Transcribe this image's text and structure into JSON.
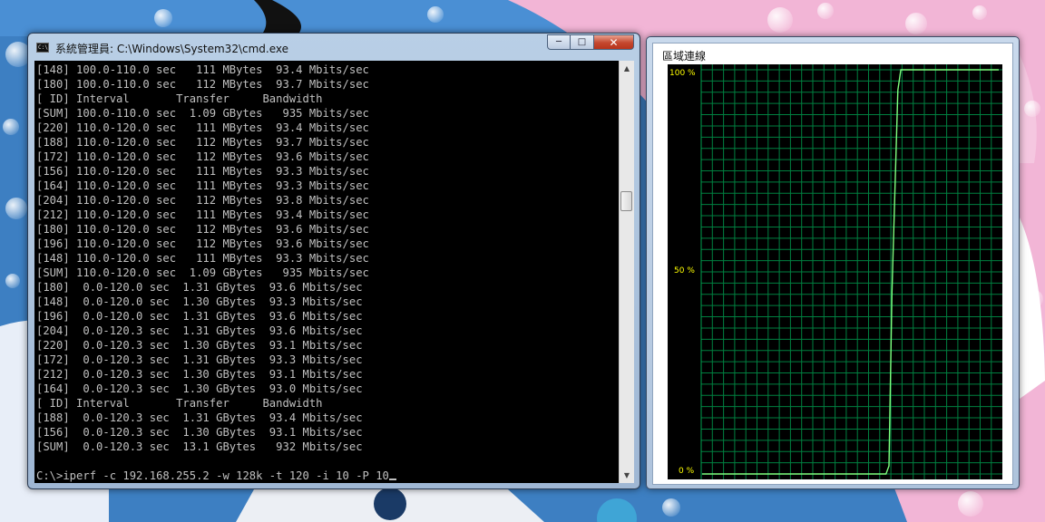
{
  "cmd": {
    "title": "系統管理員: C:\\Windows\\System32\\cmd.exe",
    "app_icon_text": "C:\\",
    "lines": [
      "[148] 100.0-110.0 sec   111 MBytes  93.4 Mbits/sec",
      "[180] 100.0-110.0 sec   112 MBytes  93.7 Mbits/sec",
      "[ ID] Interval       Transfer     Bandwidth",
      "[SUM] 100.0-110.0 sec  1.09 GBytes   935 Mbits/sec",
      "[220] 110.0-120.0 sec   111 MBytes  93.4 Mbits/sec",
      "[188] 110.0-120.0 sec   112 MBytes  93.7 Mbits/sec",
      "[172] 110.0-120.0 sec   112 MBytes  93.6 Mbits/sec",
      "[156] 110.0-120.0 sec   111 MBytes  93.3 Mbits/sec",
      "[164] 110.0-120.0 sec   111 MBytes  93.3 Mbits/sec",
      "[204] 110.0-120.0 sec   112 MBytes  93.8 Mbits/sec",
      "[212] 110.0-120.0 sec   111 MBytes  93.4 Mbits/sec",
      "[180] 110.0-120.0 sec   112 MBytes  93.6 Mbits/sec",
      "[196] 110.0-120.0 sec   112 MBytes  93.6 Mbits/sec",
      "[148] 110.0-120.0 sec   111 MBytes  93.3 Mbits/sec",
      "[SUM] 110.0-120.0 sec  1.09 GBytes   935 Mbits/sec",
      "[180]  0.0-120.0 sec  1.31 GBytes  93.6 Mbits/sec",
      "[148]  0.0-120.0 sec  1.30 GBytes  93.3 Mbits/sec",
      "[196]  0.0-120.0 sec  1.31 GBytes  93.6 Mbits/sec",
      "[204]  0.0-120.3 sec  1.31 GBytes  93.6 Mbits/sec",
      "[220]  0.0-120.3 sec  1.30 GBytes  93.1 Mbits/sec",
      "[172]  0.0-120.3 sec  1.31 GBytes  93.3 Mbits/sec",
      "[212]  0.0-120.3 sec  1.30 GBytes  93.1 Mbits/sec",
      "[164]  0.0-120.3 sec  1.30 GBytes  93.0 Mbits/sec",
      "[ ID] Interval       Transfer     Bandwidth",
      "[188]  0.0-120.3 sec  1.31 GBytes  93.4 Mbits/sec",
      "[156]  0.0-120.3 sec  1.30 GBytes  93.1 Mbits/sec",
      "[SUM]  0.0-120.3 sec  13.1 GBytes   932 Mbits/sec",
      ""
    ],
    "prompt": "C:\\>iperf -c 192.168.255.2 -w 128k -t 120 -i 10 -P 10"
  },
  "network": {
    "title": "區域連線",
    "label_100": "100 %",
    "label_50": "50 %",
    "label_0": "0 %"
  },
  "colors": {
    "graph_bg": "#000000",
    "graph_grid": "#008040",
    "graph_line": "#7fff7f",
    "label_yellow": "#ffff00"
  },
  "chart_data": {
    "type": "line",
    "y_unit": "%",
    "ylim": [
      0,
      100
    ],
    "y_ticks": [
      "0 %",
      "50 %",
      "100 %"
    ],
    "grid": true,
    "series": [
      {
        "points": [
          [
            0,
            0
          ],
          [
            62,
            0
          ],
          [
            63,
            2
          ],
          [
            64,
            45
          ],
          [
            66,
            95
          ],
          [
            67,
            100
          ],
          [
            100,
            100
          ]
        ]
      }
    ]
  }
}
